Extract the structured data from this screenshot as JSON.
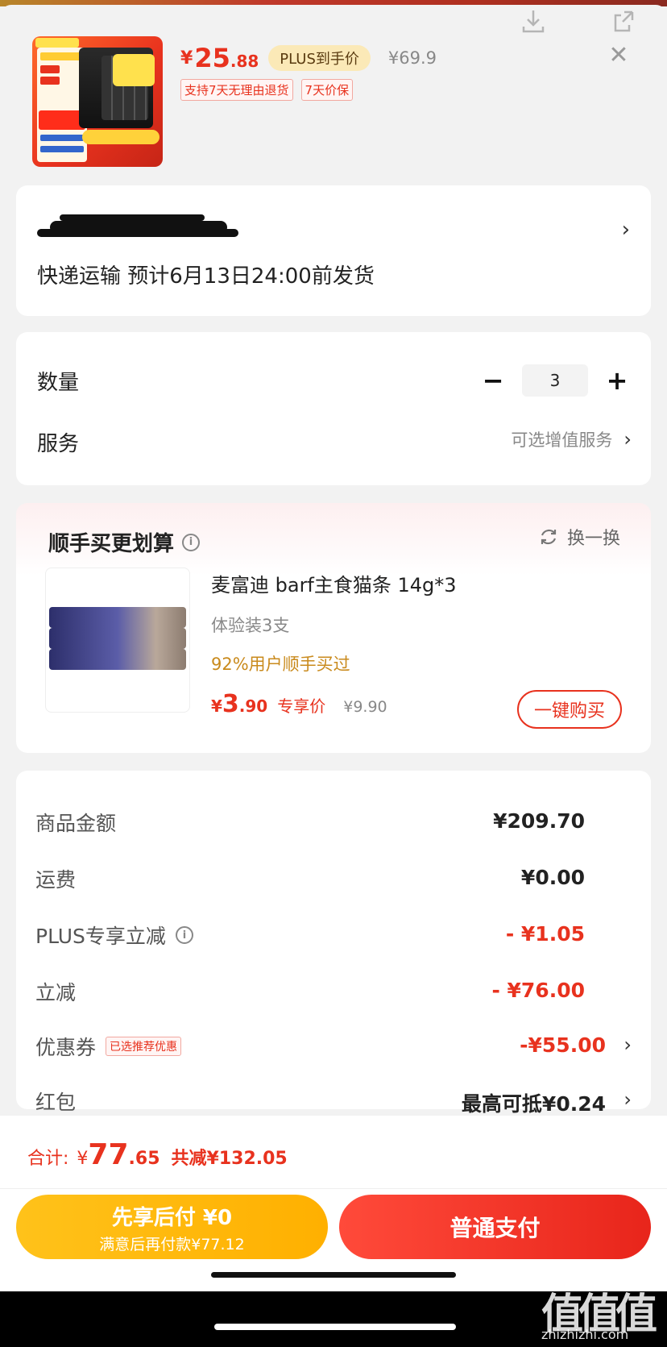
{
  "product": {
    "price_symbol": "¥",
    "price_int": "25",
    "price_dec": ".88",
    "plus_label": "PLUS到手价",
    "orig_price": "¥69.9",
    "tags": [
      "支持7天无理由退货",
      "7天价保"
    ]
  },
  "address": {
    "shipping_text": "快递运输 预计6月13日24:00前发货"
  },
  "options": {
    "quantity_label": "数量",
    "quantity_value": "3",
    "minus": "−",
    "plus": "+",
    "service_label": "服务",
    "service_value": "可选增值服务"
  },
  "recommend": {
    "title": "顺手买更划算",
    "swap_label": "换一换",
    "item_name": "麦富迪 barf主食猫条 14g*3",
    "item_sub": "体验装3支",
    "item_pct": "92%用户顺手买过",
    "price_symbol": "¥",
    "price_int": "3",
    "price_dec": ".90",
    "price_label": "专享价",
    "orig_price": "¥9.90",
    "buy_label": "一键购买"
  },
  "summary": {
    "rows": [
      {
        "label": "商品金额",
        "value": "¥209.70"
      },
      {
        "label": "运费",
        "value": "¥0.00"
      },
      {
        "label": "PLUS专享立减",
        "value": "- ¥1.05"
      },
      {
        "label": "立减",
        "value": "- ¥76.00"
      },
      {
        "label": "优惠券",
        "tag": "已选推荐优惠",
        "value": "-¥55.00"
      },
      {
        "label": "红包",
        "value": "最高可抵¥0.24"
      }
    ]
  },
  "footer": {
    "total_label": "合计:",
    "total_symbol": "¥",
    "total_int": "77",
    "total_dec": ".65",
    "total_saved": "共减¥132.05",
    "later_title": "先享后付 ¥0",
    "later_sub": "满意后再付款¥77.12",
    "pay_label": "普通支付"
  },
  "watermark": {
    "text": "值值值",
    "url": "zhizhizhi.com"
  },
  "colors": {
    "accent_red": "#e8321e",
    "accent_gold": "#ffb000"
  }
}
